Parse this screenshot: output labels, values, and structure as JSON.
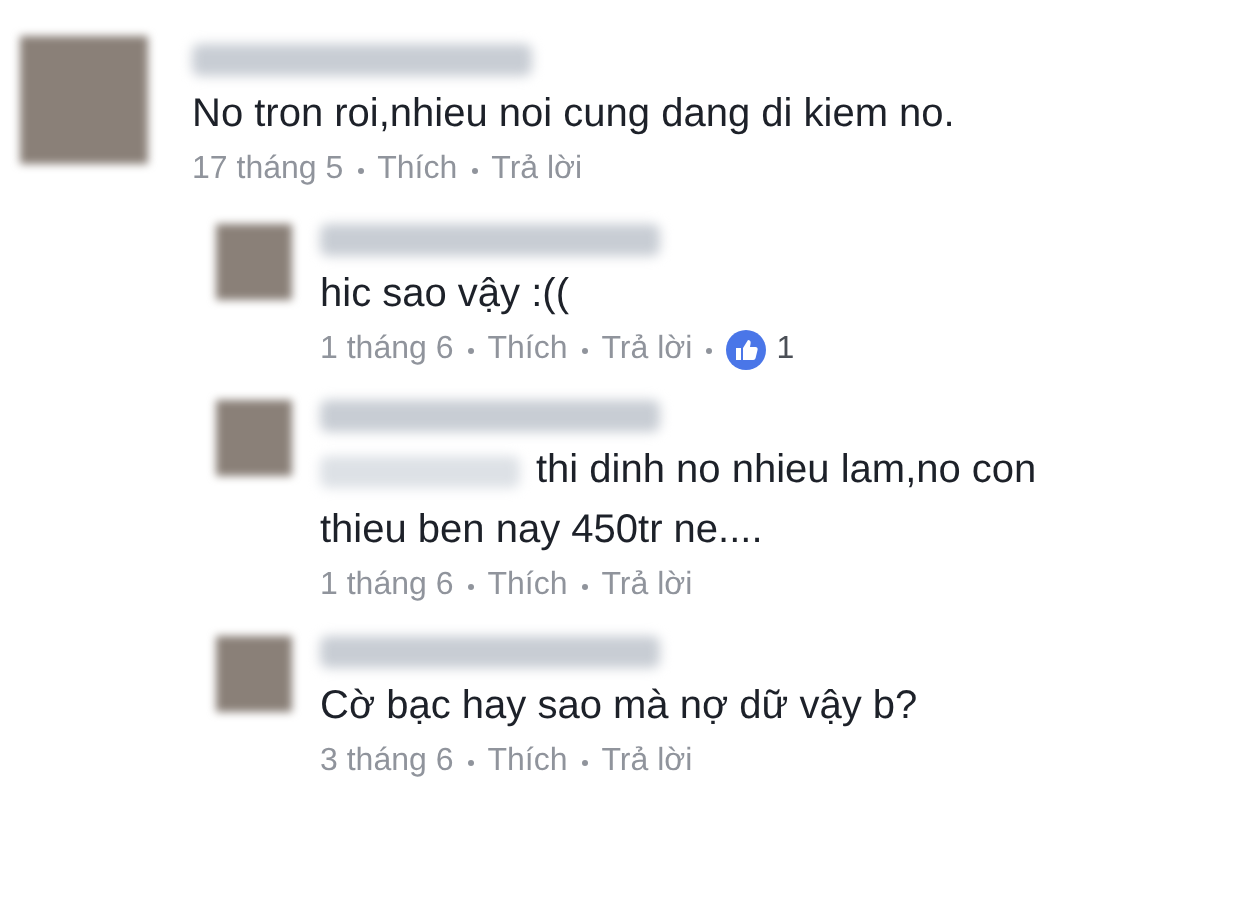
{
  "comments": [
    {
      "kind": "top",
      "mention": false,
      "text": "No tron roi,nhieu noi cung dang di kiem no.",
      "date": "17 tháng 5",
      "like": "Thích",
      "reply": "Trả lời"
    },
    {
      "kind": "reply",
      "mention": false,
      "text": "hic sao vậy :((",
      "date": "1 tháng 6",
      "like": "Thích",
      "reply": "Trả lời",
      "likes": "1"
    },
    {
      "kind": "reply",
      "mention": true,
      "text": "thi dinh no nhieu lam,no con thieu ben nay 450tr ne....",
      "date": "1 tháng 6",
      "like": "Thích",
      "reply": "Trả lời"
    },
    {
      "kind": "reply",
      "mention": false,
      "text": "Cờ bạc hay sao mà nợ dữ vậy b?",
      "date": "3 tháng 6",
      "like": "Thích",
      "reply": "Trả lời"
    }
  ]
}
